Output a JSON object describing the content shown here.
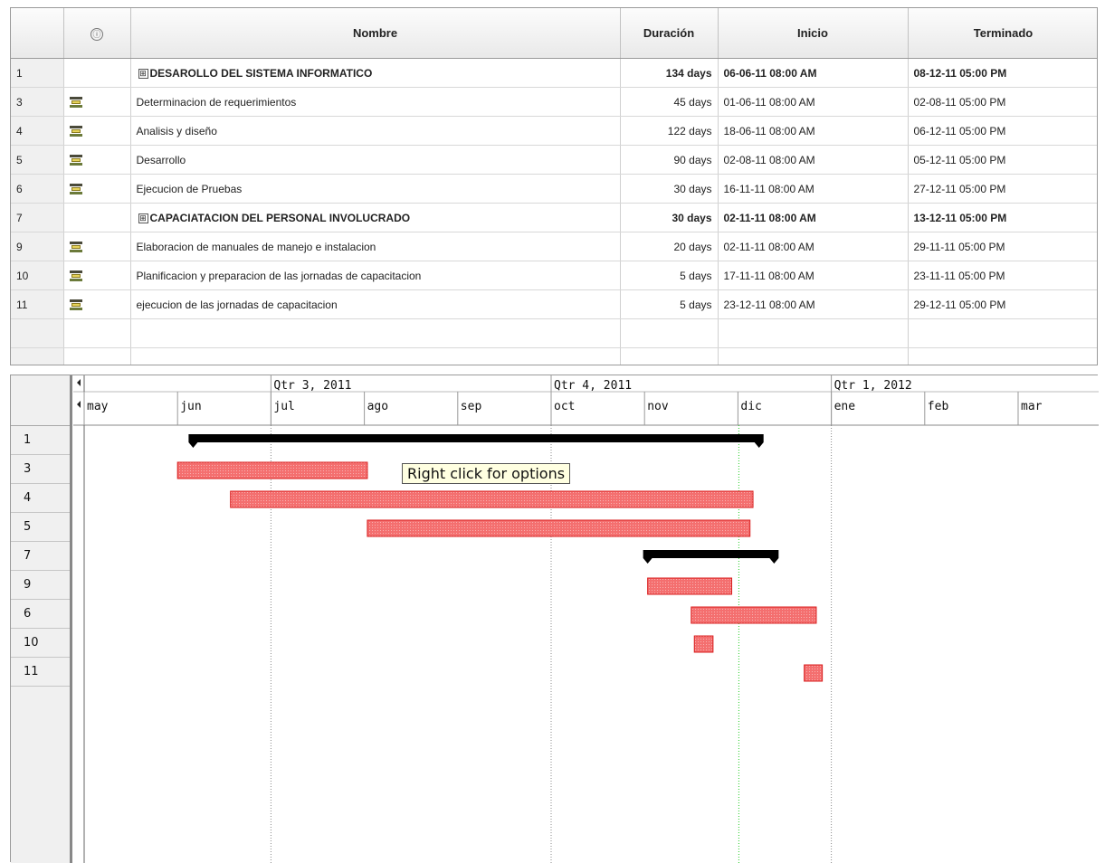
{
  "table": {
    "headers": {
      "index": "",
      "indicators": "ⓘ",
      "name": "Nombre",
      "duration": "Duración",
      "start": "Inicio",
      "finish": "Terminado"
    },
    "rows": [
      {
        "index": "1",
        "summary": true,
        "expander": "⊞",
        "name": "DESAROLLO DEL SISTEMA INFORMATICO",
        "duration": "134 days",
        "start": "06-06-11 08:00 AM",
        "finish": "08-12-11 05:00 PM"
      },
      {
        "index": "3",
        "summary": false,
        "name": "Determinacion de requerimientos",
        "duration": "45 days",
        "start": "01-06-11 08:00 AM",
        "finish": "02-08-11 05:00 PM"
      },
      {
        "index": "4",
        "summary": false,
        "name": "Analisis y diseño",
        "duration": "122 days",
        "start": "18-06-11 08:00 AM",
        "finish": "06-12-11 05:00 PM"
      },
      {
        "index": "5",
        "summary": false,
        "name": "Desarrollo",
        "duration": "90 days",
        "start": "02-08-11 08:00 AM",
        "finish": "05-12-11 05:00 PM"
      },
      {
        "index": "6",
        "summary": false,
        "name": "Ejecucion de Pruebas",
        "duration": "30 days",
        "start": "16-11-11 08:00 AM",
        "finish": "27-12-11 05:00 PM"
      },
      {
        "index": "7",
        "summary": true,
        "expander": "⊞",
        "name": "CAPACIATACION DEL PERSONAL INVOLUCRADO",
        "duration": "30 days",
        "start": "02-11-11 08:00 AM",
        "finish": "13-12-11 05:00 PM"
      },
      {
        "index": "9",
        "summary": false,
        "name": "Elaboracion de manuales de manejo e instalacion",
        "duration": "20 days",
        "start": "02-11-11 08:00 AM",
        "finish": "29-11-11 05:00 PM"
      },
      {
        "index": "10",
        "summary": false,
        "name": "Planificacion y preparacion de las jornadas de capacitacion",
        "duration": "5 days",
        "start": "17-11-11 08:00 AM",
        "finish": "23-11-11 05:00 PM"
      },
      {
        "index": "11",
        "summary": false,
        "name": "ejecucion de las jornadas de capacitacion",
        "duration": "5 days",
        "start": "23-12-11 08:00 AM",
        "finish": "29-12-11 05:00 PM"
      }
    ]
  },
  "gantt": {
    "quarters": [
      "Qtr 3, 2011",
      "Qtr 4, 2011",
      "Qtr 1, 2012"
    ],
    "months": [
      "may",
      "jun",
      "jul",
      "ago",
      "sep",
      "oct",
      "nov",
      "dic",
      "ene",
      "feb",
      "mar"
    ],
    "rows": [
      {
        "label": "1",
        "type": "summary",
        "start": "2011-06-06",
        "end": "2011-12-08"
      },
      {
        "label": "3",
        "type": "task",
        "start": "2011-06-01",
        "end": "2011-08-02"
      },
      {
        "label": "4",
        "type": "task",
        "start": "2011-06-18",
        "end": "2011-12-06"
      },
      {
        "label": "5",
        "type": "task",
        "start": "2011-08-02",
        "end": "2011-12-05"
      },
      {
        "label": "7",
        "type": "summary",
        "start": "2011-11-02",
        "end": "2011-12-13"
      },
      {
        "label": "9",
        "type": "task",
        "start": "2011-11-02",
        "end": "2011-11-29"
      },
      {
        "label": "6",
        "type": "task",
        "start": "2011-11-16",
        "end": "2011-12-27"
      },
      {
        "label": "10",
        "type": "task",
        "start": "2011-11-17",
        "end": "2011-11-23"
      },
      {
        "label": "11",
        "type": "task",
        "start": "2011-12-23",
        "end": "2011-12-29"
      }
    ],
    "tooltip": "Right click for options",
    "colors": {
      "task_fill": "#f46f6f",
      "task_border": "#d81e1e",
      "summary": "#000000",
      "today_line": "#22cc22",
      "grid": "#888888"
    }
  }
}
